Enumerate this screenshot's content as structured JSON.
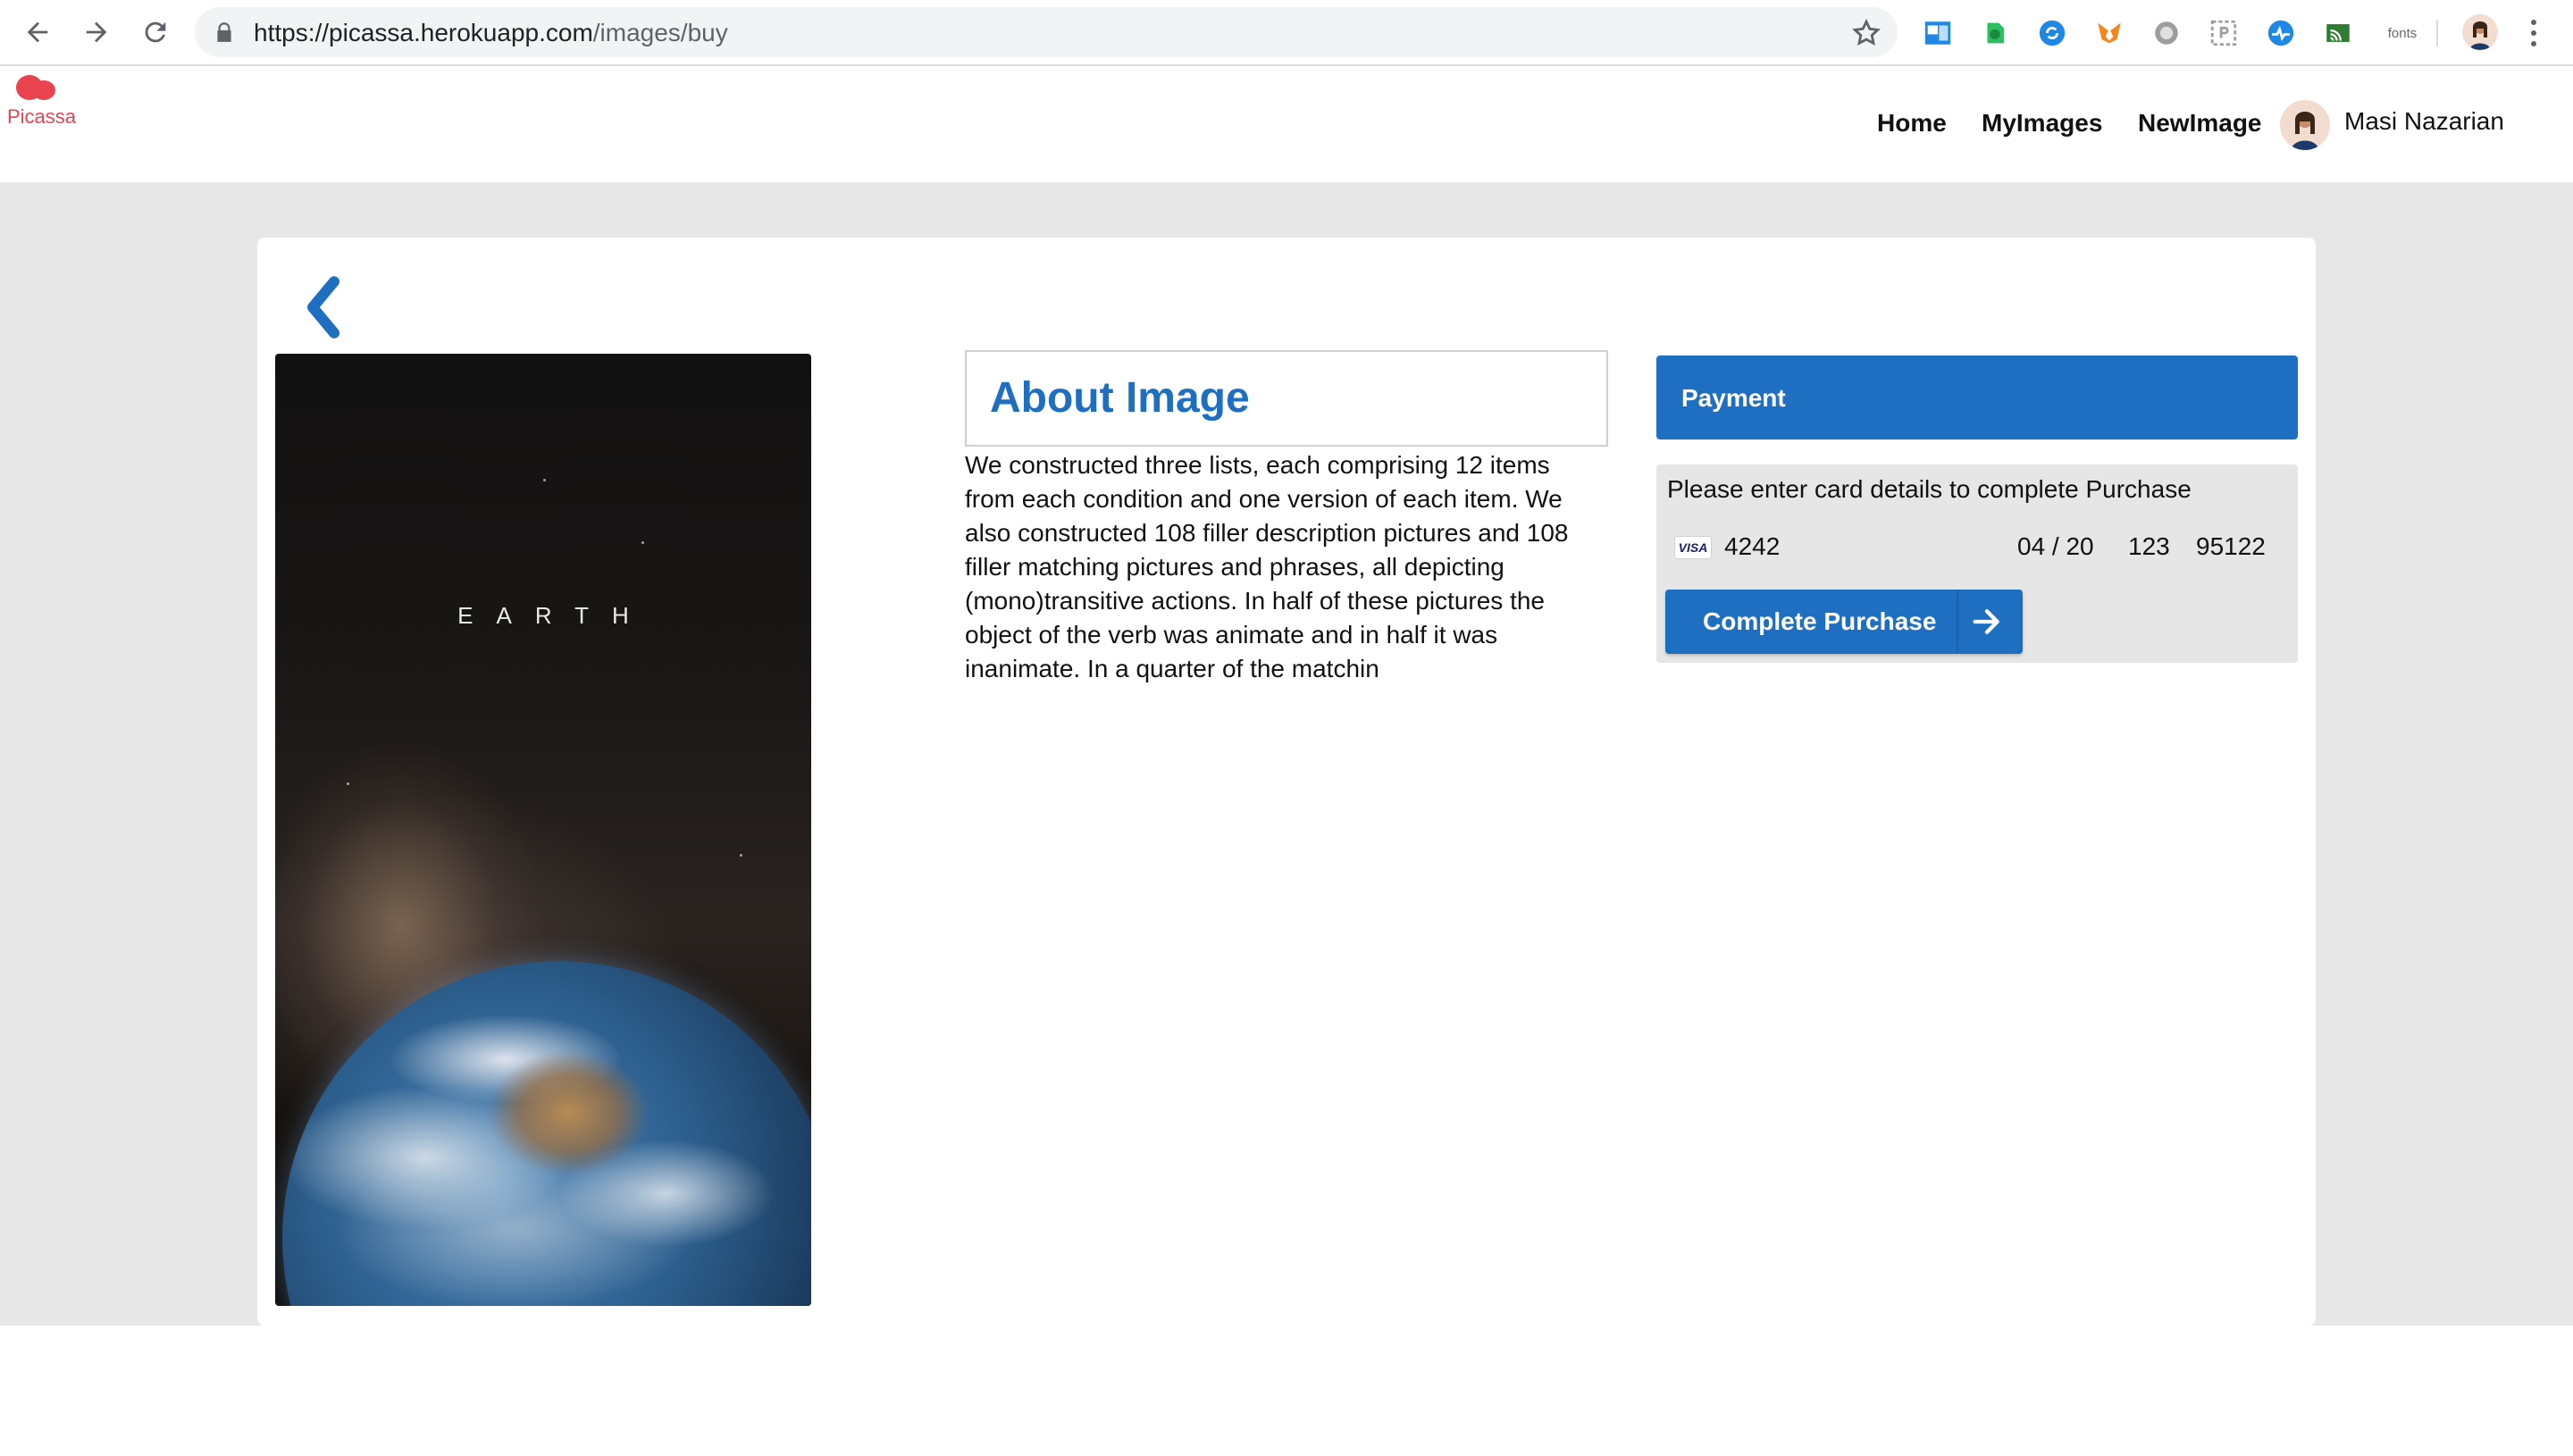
{
  "browser": {
    "url_host": "https://picassa.herokuapp.com",
    "url_path": "/images/buy",
    "extensions": [
      "photos-ext-icon",
      "evernote-icon",
      "sync-icon",
      "metamask-icon",
      "circle-ext-icon",
      "crop-ext-icon",
      "pulse-ext-icon",
      "cast-icon"
    ],
    "fonts_ext_label": "fonts"
  },
  "app": {
    "logo_text": "Picassa",
    "nav": {
      "home": "Home",
      "my_images": "MyImages",
      "new_image": "NewImage"
    },
    "user_name": "Masi Nazarian"
  },
  "image": {
    "title": "EARTH"
  },
  "about": {
    "title": "About Image",
    "description": "We constructed three lists, each comprising 12 items from each condition and one version of each item. We also constructed 108 filler description pictures and 108 filler matching pictures and phrases, all depicting (mono)transitive actions. In half of these pictures the object of the verb was animate and in half it was inanimate. In a quarter of the matchin"
  },
  "payment": {
    "header": "Payment",
    "instructions": "Please enter card details to complete Purchase",
    "card_brand": "VISA",
    "card_number": "4242",
    "expiry": "04 / 20",
    "cvc": "123",
    "zip": "95122",
    "button_label": "Complete Purchase"
  },
  "colors": {
    "accent": "#1e6fc2",
    "logo": "#e8434f",
    "page_bg": "#e7e7e7"
  }
}
